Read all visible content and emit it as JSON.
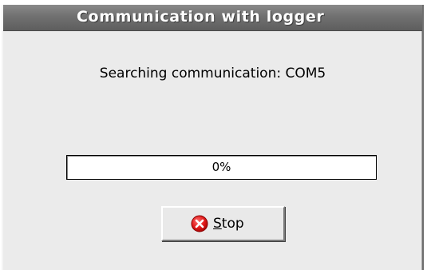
{
  "window": {
    "title": "Communication with logger"
  },
  "status": {
    "message": "Searching communication: COM5"
  },
  "progress": {
    "value": 0,
    "label": "0%"
  },
  "stop_button": {
    "mnemonic": "S",
    "label_rest": "top",
    "icon": "stop-icon"
  },
  "colors": {
    "titlebar": "#707070",
    "dialog_background": "#ebebeb",
    "stop_icon": "#e01818"
  }
}
